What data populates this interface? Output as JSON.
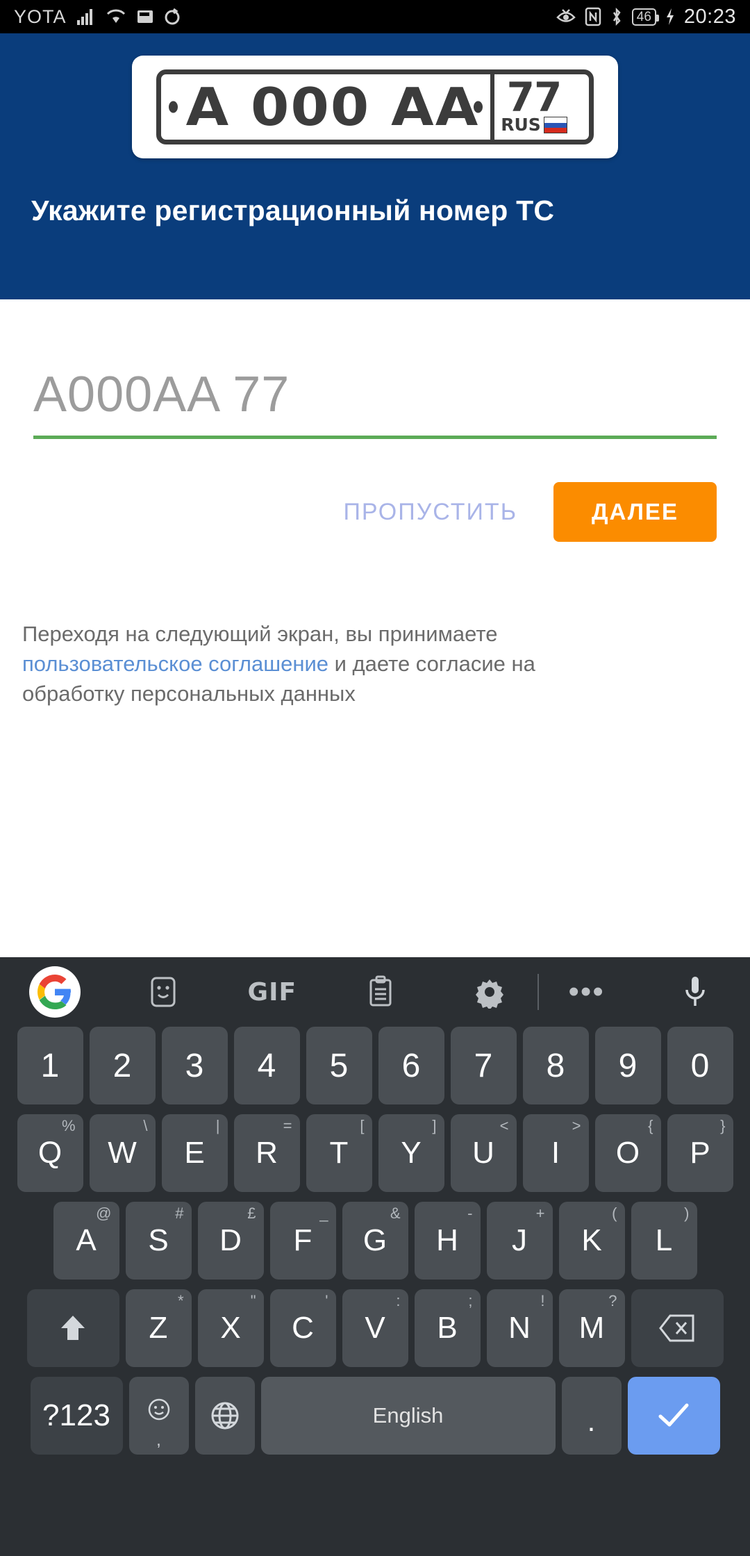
{
  "status_bar": {
    "carrier": "YOTA",
    "time": "20:23",
    "battery_percent": "46",
    "icons_left": [
      "signal-icon",
      "wifi-icon",
      "sim-icon",
      "sync-icon"
    ],
    "icons_right": [
      "eye-comfort-icon",
      "nfc-icon",
      "bluetooth-icon",
      "battery-icon",
      "charging-bolt-icon"
    ]
  },
  "header": {
    "bg_color": "#0a3d7c",
    "title": "Укажите регистрационный номер ТС",
    "plate": {
      "main_text": "A 000 AA",
      "region_number": "77",
      "country_code": "RUS",
      "flag": "russia-flag-icon"
    }
  },
  "form": {
    "input": {
      "value": "",
      "placeholder": "A000AA 77",
      "underline_color": "#5cab57"
    },
    "skip_button": "ПРОПУСТИТЬ",
    "next_button": "ДАЛЕЕ",
    "next_button_color": "#fb8c00",
    "disclaimer": {
      "part1": "Переходя на следующий экран, вы принимаете ",
      "link": "пользовательское соглашение",
      "part2": " и даете согласие на обработку персональных данных",
      "link_color": "#5b8fd4"
    }
  },
  "keyboard": {
    "toolbar": [
      {
        "name": "google-logo-icon",
        "label": "G"
      },
      {
        "name": "sticker-icon",
        "label": ""
      },
      {
        "name": "gif-icon",
        "label": "GIF"
      },
      {
        "name": "clipboard-icon",
        "label": ""
      },
      {
        "name": "gear-icon",
        "label": ""
      },
      {
        "name": "more-options-icon",
        "label": "•••"
      },
      {
        "name": "microphone-icon",
        "label": ""
      }
    ],
    "row_numbers": [
      "1",
      "2",
      "3",
      "4",
      "5",
      "6",
      "7",
      "8",
      "9",
      "0"
    ],
    "row_qwerty": [
      {
        "key": "Q",
        "sup": "%"
      },
      {
        "key": "W",
        "sup": "\\"
      },
      {
        "key": "E",
        "sup": "|"
      },
      {
        "key": "R",
        "sup": "="
      },
      {
        "key": "T",
        "sup": "["
      },
      {
        "key": "Y",
        "sup": "]"
      },
      {
        "key": "U",
        "sup": "<"
      },
      {
        "key": "I",
        "sup": ">"
      },
      {
        "key": "O",
        "sup": "{"
      },
      {
        "key": "P",
        "sup": "}"
      }
    ],
    "row_asdf": [
      {
        "key": "A",
        "sup": "@"
      },
      {
        "key": "S",
        "sup": "#"
      },
      {
        "key": "D",
        "sup": "£"
      },
      {
        "key": "F",
        "sup": "_"
      },
      {
        "key": "G",
        "sup": "&"
      },
      {
        "key": "H",
        "sup": "-"
      },
      {
        "key": "J",
        "sup": "+"
      },
      {
        "key": "K",
        "sup": "("
      },
      {
        "key": "L",
        "sup": ")"
      }
    ],
    "row_zxcv": [
      {
        "key": "Z",
        "sup": "*"
      },
      {
        "key": "X",
        "sup": "\""
      },
      {
        "key": "C",
        "sup": "'"
      },
      {
        "key": "V",
        "sup": ":"
      },
      {
        "key": "B",
        "sup": ";"
      },
      {
        "key": "N",
        "sup": "!"
      },
      {
        "key": "M",
        "sup": "?"
      }
    ],
    "shift_key": "shift-icon",
    "delete_key": "backspace-icon",
    "symbols_key": "?123",
    "emoji_key": "emoji-icon",
    "emoji_sub": ",",
    "language_key": "globe-icon",
    "space_key": "English",
    "period_key": ".",
    "enter_key": "checkmark-icon",
    "enter_color": "#6b9cf0"
  }
}
